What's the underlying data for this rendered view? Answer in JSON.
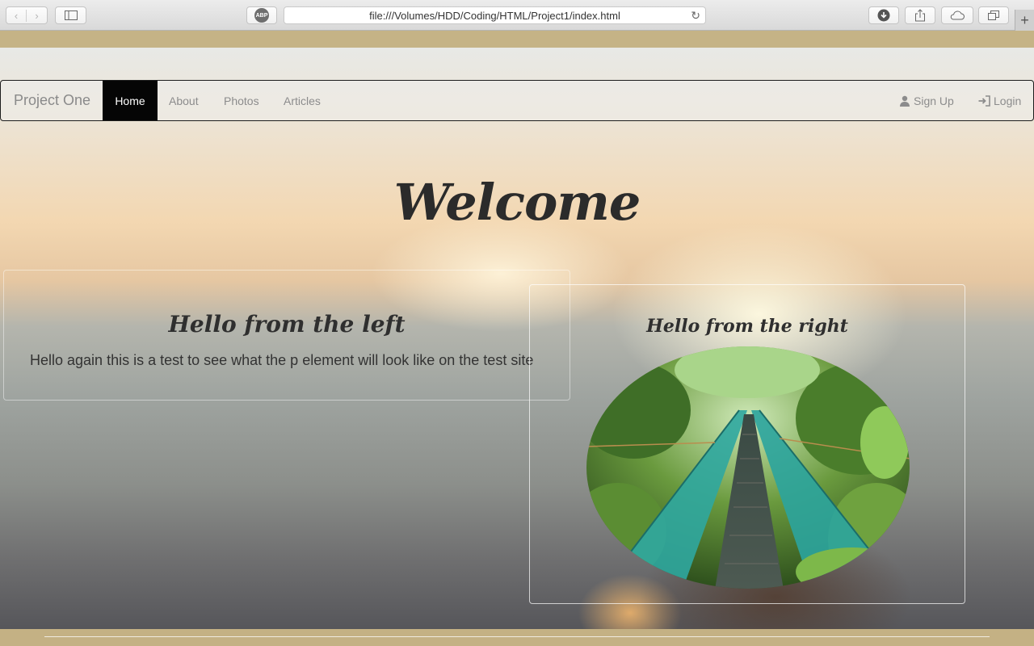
{
  "browser": {
    "url": "file:///Volumes/HDD/Coding/HTML/Project1/index.html",
    "adblock_label": "ABP",
    "new_tab_label": "+"
  },
  "navbar": {
    "brand": "Project One",
    "links": [
      "Home",
      "About",
      "Photos",
      "Articles"
    ],
    "active": "Home",
    "right": {
      "signup": "Sign Up",
      "login": "Login"
    }
  },
  "hero": {
    "heading": "Welcome"
  },
  "left_panel": {
    "heading": "Hello from the left",
    "text": "Hello again this is a test to see what the p element will look like on the test site"
  },
  "right_panel": {
    "heading": "Hello from the right"
  }
}
